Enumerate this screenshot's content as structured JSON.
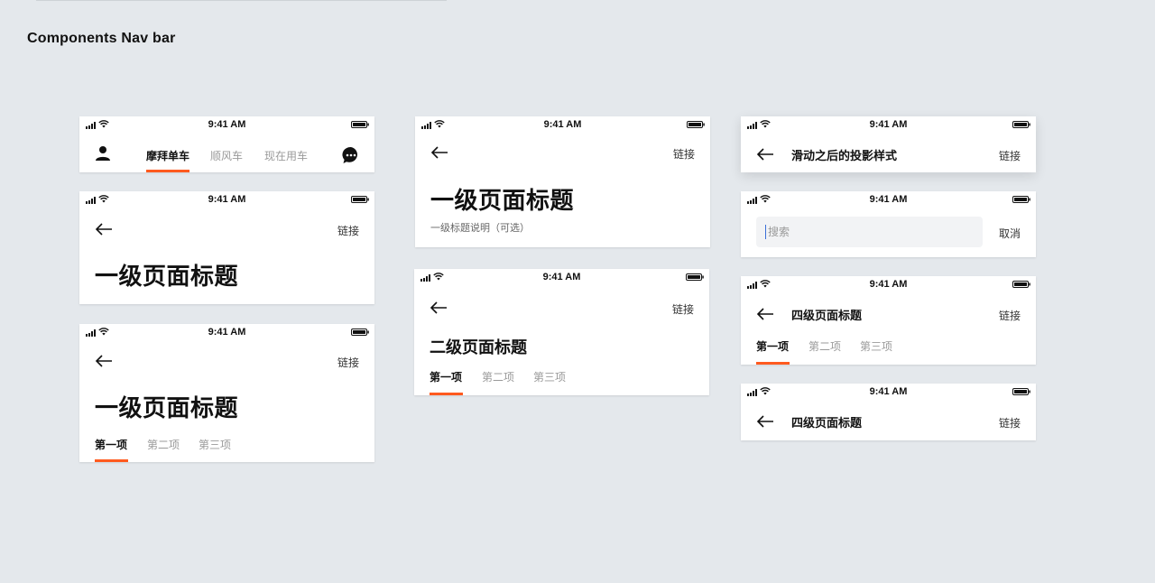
{
  "title": "Components  Nav bar",
  "status_time": "9:41 AM",
  "cards": {
    "home": {
      "tabs": [
        "摩拜单车",
        "顺风车",
        "现在用车"
      ]
    },
    "large_title": {
      "link": "链接",
      "title": "一级页面标题"
    },
    "large_title_tabs": {
      "link": "链接",
      "title": "一级页面标题",
      "tabs": [
        "第一项",
        "第二项",
        "第三项"
      ]
    },
    "large_title_subtitle": {
      "link": "链接",
      "title": "一级页面标题",
      "subtitle": "一级标题说明（可选）"
    },
    "secondary_tabs": {
      "link": "链接",
      "title": "二级页面标题",
      "tabs": [
        "第一项",
        "第二项",
        "第三项"
      ]
    },
    "scrolled": {
      "title": "滑动之后的投影样式",
      "link": "链接"
    },
    "search": {
      "placeholder": "搜索",
      "cancel": "取消"
    },
    "quaternary_tabs": {
      "title": "四级页面标题",
      "link": "链接",
      "tabs": [
        "第一项",
        "第二项",
        "第三项"
      ]
    },
    "quaternary": {
      "title": "四级页面标题",
      "link": "链接"
    }
  },
  "colors": {
    "accent": "#ff5a1f",
    "background": "#e4e8ec",
    "caret": "#3a6fd8"
  },
  "icons": [
    "signal-icon",
    "wifi-icon",
    "battery-icon",
    "back-arrow-icon",
    "user-icon",
    "chat-icon"
  ]
}
